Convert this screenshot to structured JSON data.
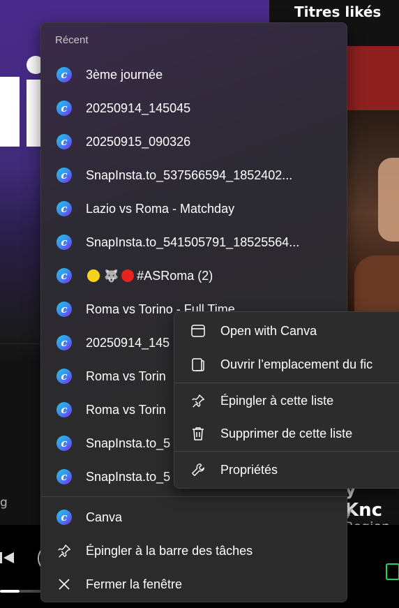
{
  "spotify": {
    "liked_title": "Titres likés",
    "track_title": "y Knc",
    "track_artist": "y Regien",
    "left_text": "g"
  },
  "jumplist": {
    "section_title": "Récent",
    "recent_items": [
      {
        "label": "3ème journée"
      },
      {
        "label": "20250914_145045"
      },
      {
        "label": "20250915_090326"
      },
      {
        "label": "SnapInsta.to_537566594_1852402..."
      },
      {
        "label": "Lazio vs Roma - Matchday"
      },
      {
        "label": "SnapInsta.to_541505791_18525564..."
      },
      {
        "label": "#ASRoma (2)"
      },
      {
        "label": "Roma vs Torino - Full Time"
      },
      {
        "label": "20250914_145"
      },
      {
        "label": "Roma vs Torin"
      },
      {
        "label": "Roma vs Torin"
      },
      {
        "label": "SnapInsta.to_5"
      },
      {
        "label": "SnapInsta.to_5"
      }
    ],
    "tasks": {
      "app": "Canva",
      "pin": "Épingler à la barre des tâches",
      "close": "Fermer la fenêtre"
    }
  },
  "context_menu": {
    "items": [
      {
        "label": "Open with Canva",
        "icon": "window-icon"
      },
      {
        "label": "Ouvrir l’emplacement du fic",
        "icon": "folder-icon"
      },
      {
        "label": "Épingler à cette liste",
        "icon": "pin-icon"
      },
      {
        "label": "Supprimer de cette liste",
        "icon": "trash-icon"
      },
      {
        "label": "Propriétés",
        "icon": "wrench-icon"
      }
    ]
  },
  "colors": {
    "accent_green": "#1ed760",
    "canva_gradient_start": "#24c7e6",
    "canva_gradient_end": "#7d2ae8"
  }
}
